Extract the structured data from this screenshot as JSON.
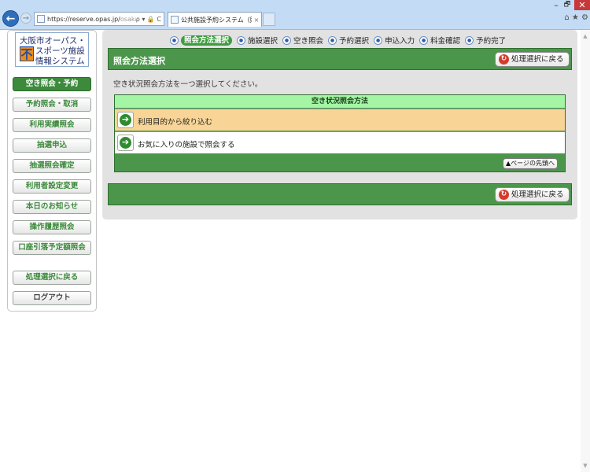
{
  "browser": {
    "window_controls": {
      "minimize": "–",
      "maximize": "🗗",
      "close": "✕"
    },
    "address": {
      "url_main": "https://reserve.opas.jp/",
      "url_rest": "osakashi/",
      "tools": "ρ ▾ 🔒 C"
    },
    "tab": {
      "title": "公共施設予約システム（照...",
      "close": "×"
    },
    "toolbar_icons": "⌂ ★ ⚙"
  },
  "logo": {
    "line1": "大阪市オーパス・",
    "line2": "スポーツ施設",
    "line3": "情報システム",
    "mark": "不"
  },
  "sidebar": {
    "items": [
      {
        "label": "空き照会・予約"
      },
      {
        "label": "予約照会・取消"
      },
      {
        "label": "利用実績照会"
      },
      {
        "label": "抽選申込"
      },
      {
        "label": "抽選照会確定"
      },
      {
        "label": "利用者設定変更"
      },
      {
        "label": "本日のお知らせ"
      },
      {
        "label": "操作履歴照会"
      },
      {
        "label": "口座引落予定額照会"
      }
    ],
    "back_label": "処理選択に戻る",
    "logout_label": "ログアウト"
  },
  "steps": [
    {
      "label": "照会方法選択"
    },
    {
      "label": "施設選択"
    },
    {
      "label": "空き照会"
    },
    {
      "label": "予約選択"
    },
    {
      "label": "申込入力"
    },
    {
      "label": "料金確認"
    },
    {
      "label": "予約完了"
    }
  ],
  "header": {
    "title": "照会方法選択",
    "back_label": "処理選択に戻る"
  },
  "instruction": "空き状況照会方法を一つ選択してください。",
  "method_table": {
    "heading": "空き状況照会方法",
    "options": [
      {
        "label": "利用目的から絞り込む"
      },
      {
        "label": "お気に入りの施設で照会する"
      }
    ],
    "page_top_label": "▲ページの先頭へ"
  },
  "footer": {
    "back_label": "処理選択に戻る"
  },
  "colors": {
    "accent_green": "#4b964b",
    "highlight_row": "#f8d596",
    "table_head": "#a4f6a4"
  }
}
